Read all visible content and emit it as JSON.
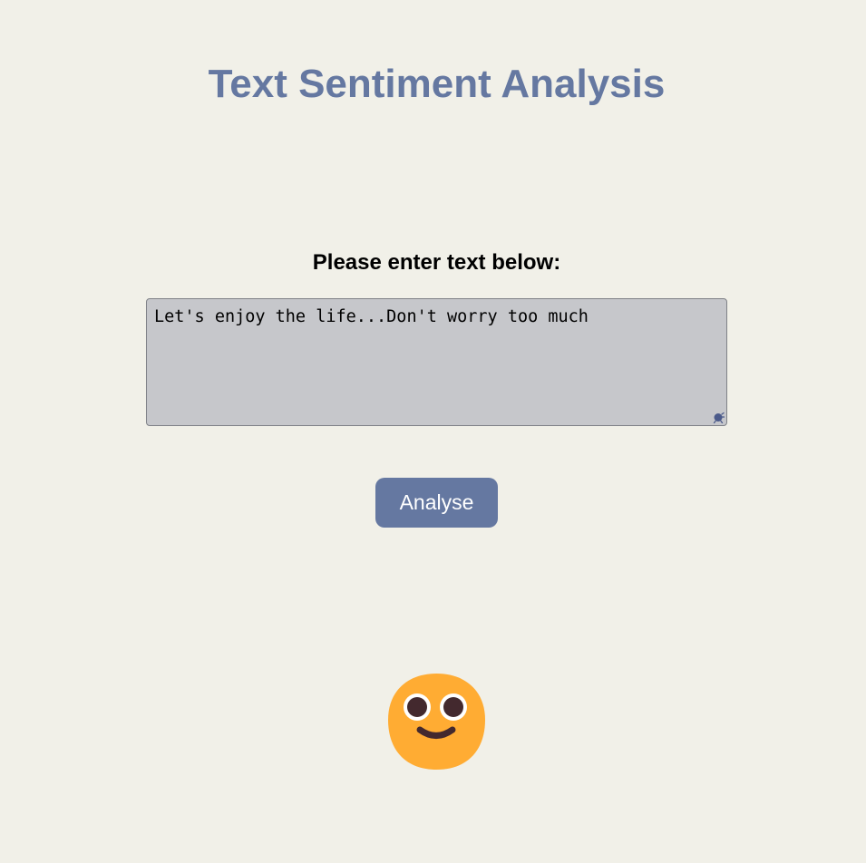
{
  "page": {
    "title": "Text Sentiment Analysis",
    "prompt": "Please enter text below:"
  },
  "input": {
    "value": "Let's enjoy the life...Don't worry too much"
  },
  "actions": {
    "analyse_label": "Analyse"
  },
  "result": {
    "sentiment_icon": "smiling-face-icon"
  },
  "colors": {
    "accent": "#6578a1",
    "background": "#f1f0e8",
    "textarea_background": "#c6c7cb",
    "emoji_face": "#ffac33",
    "emoji_features": "#43292e"
  }
}
